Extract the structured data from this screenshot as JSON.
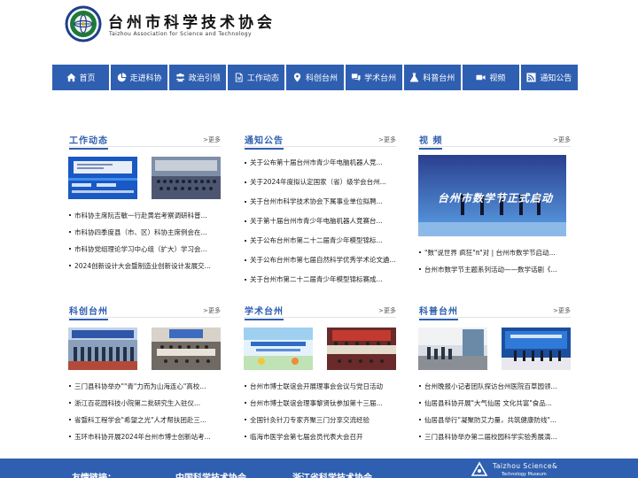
{
  "header": {
    "title_cn": "台州市科学技术协会",
    "title_en": "Taizhou Association for Science and Technology"
  },
  "nav": [
    {
      "label": "首页",
      "icon": "home-icon"
    },
    {
      "label": "走进科协",
      "icon": "pie-chart-icon"
    },
    {
      "label": "政治引领",
      "icon": "people-icon"
    },
    {
      "label": "工作动态",
      "icon": "document-icon"
    },
    {
      "label": "科创台州",
      "icon": "location-pin-icon"
    },
    {
      "label": "学术台州",
      "icon": "chat-icon"
    },
    {
      "label": "科普台州",
      "icon": "flask-icon"
    },
    {
      "label": "视频",
      "icon": "video-camera-icon"
    },
    {
      "label": "通知公告",
      "icon": "rss-icon"
    }
  ],
  "more_label": ">更多",
  "sections": {
    "work": {
      "title": "工作动态",
      "items": [
        "市科协主席阮吉敏一行赴黄岩考察调研科普...",
        "市科协四季度县（市、区）科协主席例会在...",
        "市科协党组理论学习中心组（扩大）学习会...",
        "2024创新设计大会暨制造业创新设计发展交..."
      ]
    },
    "notice": {
      "title": "通知公告",
      "items": [
        "关于公布第十届台州市青少年电脑机器人竞...",
        "关于2024年度拟认定国家（省）级学会台州...",
        "关于台州市科学技术协会下属事业单位拟聘...",
        "关于第十届台州市青少年电脑机器人竞赛台...",
        "关于公布台州市第二十二届青少年模型锦标...",
        "关于公布台州市第七届自然科学优秀学术论文遴...",
        "关于台州市第二十二届青少年模型锦标赛成..."
      ]
    },
    "video": {
      "title": "视  频",
      "banner": "台州市数学节正式启动",
      "items": [
        "\"数\"说世界 疯狂\"π\"对 | 台州市数学节启动...",
        "台州市数学节主题系列活动——数学话剧《..."
      ]
    },
    "innovation": {
      "title": "科创台州",
      "items": [
        "三门县科协举办\"\"青\"力而为山海连心\"高校...",
        "浙江百花园科技小院第二批研究生入驻仪...",
        "省暨科工程学会\"希望之光\"人才帮扶团赴三...",
        "玉环市科协开展2024年台州市博士创新站考..."
      ]
    },
    "academic": {
      "title": "学术台州",
      "items": [
        "台州市博士联谊会开展理事会会议与党日活动",
        "台州市博士联谊会理事黎贤钛参加第十三届...",
        "全国针灸针刀专家齐聚三门分享交流经验",
        "临海市医学会第七届会员代表大会召开"
      ]
    },
    "popsci": {
      "title": "科普台州",
      "items": [
        "台州晚报小记者团队探访台州医院百草园领...",
        "仙居县科协开展\"大气仙居 文化共富\"食品...",
        "仙居县举行\"凝聚防艾力量，共筑健康防线\"...",
        "三门县科协举办第二届校园科学实验秀展演..."
      ]
    }
  },
  "footer": {
    "links_label": "友情链接：",
    "link1": "中国科学技术协会",
    "link2": "浙江省科学技术协会",
    "museum_en1": "Taizhou Science&",
    "museum_en2": "Technology Museum"
  },
  "colors": {
    "brand_blue": "#2f5fb0",
    "footer_blue": "#2f5fb0",
    "logo_green": "#1f7a3a"
  }
}
